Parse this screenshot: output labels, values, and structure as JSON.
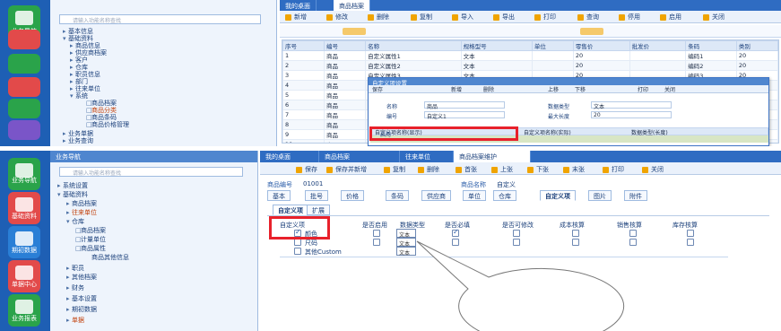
{
  "top": {
    "rail": [
      {
        "label": "业务导航",
        "color": "#2aa34a"
      },
      {
        "label": "",
        "color": "#e24a4a"
      },
      {
        "label": "",
        "color": "#2aa34a"
      },
      {
        "label": "",
        "color": "#e24a4a"
      },
      {
        "label": "",
        "color": "#2aa34a"
      },
      {
        "label": "",
        "color": "#7a55c8"
      }
    ],
    "nav": {
      "search_placeholder": "请输入功能名称查找",
      "items": [
        "基本信息",
        "基础资料",
        "商品信息",
        "供应商档案",
        "客户",
        "仓库",
        "职员信息",
        "部门",
        "往来单位",
        "价格管理",
        "系统",
        "商品档案",
        "商品分类",
        "商品条码",
        "商品价格管理",
        "业务单据",
        "业务查询"
      ]
    },
    "tabs": [
      "我的桌面",
      "商品档案"
    ],
    "toolbar": [
      "新增",
      "修改",
      "删除",
      "复制",
      "导入",
      "导出",
      "打印",
      "查询",
      "停用",
      "启用",
      "关闭"
    ],
    "columns": [
      "序号",
      "编号",
      "名称",
      "规格型号",
      "单位",
      "零售价",
      "批发价",
      "条码",
      "类别"
    ],
    "rows": [
      [
        "1",
        "商品",
        "自定义属性1",
        "文本",
        "",
        "20",
        "",
        "编码1",
        "20"
      ],
      [
        "2",
        "商品",
        "自定义属性2",
        "文本",
        "",
        "20",
        "",
        "编码2",
        "20"
      ],
      [
        "3",
        "商品",
        "自定义属性3",
        "文本",
        "",
        "20",
        "",
        "编码3",
        "20"
      ],
      [
        "4",
        "商品",
        "自定义属性4",
        "文本",
        "",
        "20",
        "",
        "编码4",
        "20"
      ],
      [
        "5",
        "商品",
        "",
        "",
        "",
        "",
        "",
        "",
        ""
      ],
      [
        "6",
        "商品",
        "",
        "",
        "",
        "",
        "",
        "",
        ""
      ],
      [
        "7",
        "商品",
        "",
        "",
        "",
        "",
        "",
        "",
        ""
      ],
      [
        "8",
        "商品",
        "",
        "",
        "",
        "",
        "",
        "",
        ""
      ],
      [
        "9",
        "商品",
        "",
        "",
        "",
        "",
        "",
        "",
        ""
      ],
      [
        "10",
        "商品",
        "",
        "",
        "",
        "",
        "",
        "",
        ""
      ],
      [
        "11",
        "商品",
        "",
        "",
        "",
        "",
        "",
        "",
        ""
      ],
      [
        "12",
        "商品",
        "",
        "",
        "",
        "",
        "",
        "",
        ""
      ],
      [
        "13",
        "商品",
        "",
        "",
        "",
        "",
        "",
        "",
        ""
      ],
      [
        "14",
        "商品",
        "",
        "",
        "",
        "",
        "",
        "",
        ""
      ]
    ],
    "modal": {
      "title": "自定义项设置",
      "toolbar": [
        "保存",
        "新增",
        "删除",
        "上移",
        "下移",
        "打印",
        "关闭"
      ],
      "fields": [
        {
          "label": "名称",
          "value": "商品",
          "label2": "数据类型",
          "value2": "文本"
        },
        {
          "label": "编号",
          "value": "自定义1",
          "label2": "最大长度",
          "value2": "20"
        }
      ],
      "grid_headers": [
        "自定义项名称(显示)",
        "自定义项名称(实际)",
        "数据类型(长度)"
      ],
      "highlight": "启用"
    }
  },
  "bottom": {
    "rail": [
      {
        "label": "业务导航",
        "color": "#2aa34a"
      },
      {
        "label": "基础资料",
        "color": "#e24a4a"
      },
      {
        "label": "期初数据",
        "color": "#2a7fd6"
      },
      {
        "label": "单据中心",
        "color": "#e24a4a"
      },
      {
        "label": "业务报表",
        "color": "#2aa34a"
      }
    ],
    "nav": {
      "title": "业务导航",
      "search_placeholder": "请输入功能名称查找",
      "items": [
        "系统设置",
        "基础资料",
        "商品档案",
        "往来单位",
        "仓库",
        "商品档案",
        "计量单位",
        "商品属性",
        "商品其他信息",
        "职员",
        "其他档案",
        "财务",
        "基本设置",
        "期初数据",
        "单据"
      ]
    },
    "tabs": [
      "我的桌面",
      "商品档案",
      "往来单位",
      "商品档案维护"
    ],
    "toolbar": [
      "保存",
      "保存并新增",
      "复制",
      "删除",
      "首张",
      "上张",
      "下张",
      "末张",
      "打印",
      "关闭"
    ],
    "form": {
      "code_label": "商品编号",
      "code_value": "01001",
      "name_label": "商品名称",
      "name_value": "自定义"
    },
    "subtabs": [
      "基本",
      "批号",
      "价格",
      "条码",
      "供应商",
      "单位",
      "仓库",
      "自定义项",
      "图片",
      "附件"
    ],
    "inner_tabs": [
      "自定义项",
      "扩展"
    ],
    "table": {
      "headers": [
        "自定义项",
        "是否启用",
        "数据类型",
        "是否必填",
        "是否可修改",
        "成本核算",
        "销售核算",
        "库存核算"
      ],
      "rows": [
        {
          "name": "颜色",
          "checked": true,
          "type": "文本"
        },
        {
          "name": "尺码",
          "checked": false,
          "type": "文本"
        },
        {
          "name": "其他Custom",
          "checked": false,
          "type": "文本"
        }
      ]
    }
  }
}
